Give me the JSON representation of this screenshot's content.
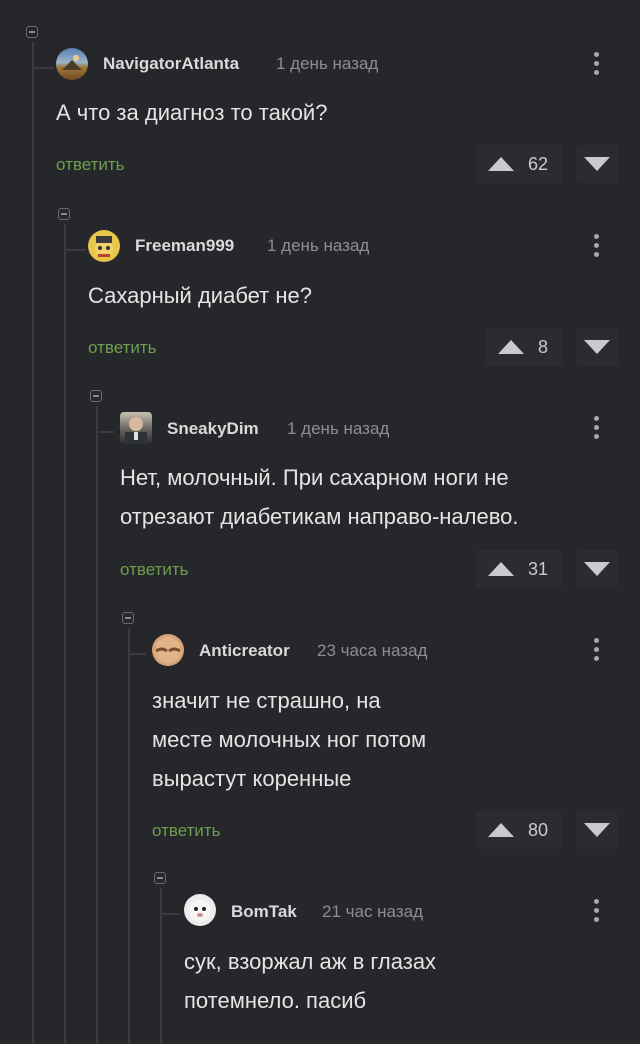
{
  "comments": [
    {
      "author": "NavigatorAtlanta",
      "time": "1 день назад",
      "text": "А что за диагноз то такой?",
      "reply_label": "ответить",
      "votes": "62"
    },
    {
      "author": "Freeman999",
      "time": "1 день назад",
      "text": "Сахарный диабет не?",
      "reply_label": "ответить",
      "votes": "8"
    },
    {
      "author": "SneakyDim",
      "time": "1 день назад",
      "text_lines": [
        "Нет, молочный. При сахарном ноги не",
        "отрезают диабетикам направо-налево."
      ],
      "reply_label": "ответить",
      "votes": "31"
    },
    {
      "author": "Anticreator",
      "time": "23 часа назад",
      "text_lines": [
        "значит не страшно, на",
        "месте молочных ног потом",
        "вырастут коренные"
      ],
      "reply_label": "ответить",
      "votes": "80"
    },
    {
      "author": "BomTak",
      "time": "21 час назад",
      "text_lines": [
        "сук, взоржал аж в глазах",
        "потемнело. пасиб"
      ]
    }
  ],
  "colors": {
    "background": "#26272b",
    "reply_link": "#6e9e4f",
    "thread_line": "#3b3c41"
  },
  "icons": [
    "collapse-icon",
    "more-vertical-icon",
    "upvote-icon",
    "downvote-icon"
  ]
}
